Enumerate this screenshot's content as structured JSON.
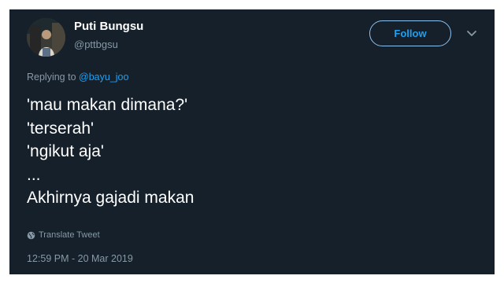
{
  "user": {
    "display_name": "Puti Bungsu",
    "handle": "@pttbgsu",
    "avatar_icon": "profile-photo"
  },
  "follow": {
    "label": "Follow"
  },
  "menu": {
    "icon": "chevron-down-icon"
  },
  "reply": {
    "prefix": "Replying to",
    "mention": "@bayu_joo"
  },
  "tweet": {
    "lines": [
      "'mau makan dimana?'",
      "'terserah'",
      "'ngikut aja'",
      "...",
      "Akhirnya gajadi makan"
    ]
  },
  "translate": {
    "label": "Translate Tweet",
    "icon": "globe-icon"
  },
  "meta": {
    "timestamp": "12:59 PM - 20 Mar 2019"
  },
  "colors": {
    "background": "#15202b",
    "accent": "#1da1f2",
    "secondary_text": "#8899a6",
    "primary_text": "#ffffff"
  }
}
